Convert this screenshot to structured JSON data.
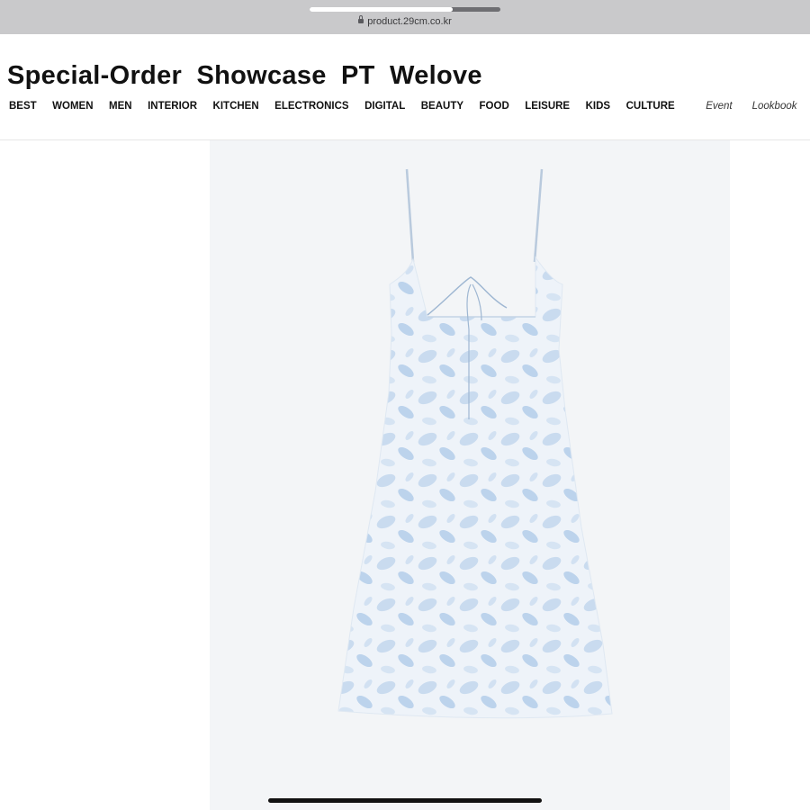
{
  "browser": {
    "url": "product.29cm.co.kr",
    "load_progress": 0.75
  },
  "site": {
    "title": "Special-Order  Showcase  PT  Welove"
  },
  "nav": {
    "categories": [
      "BEST",
      "WOMEN",
      "MEN",
      "INTERIOR",
      "KITCHEN",
      "ELECTRONICS",
      "DIGITAL",
      "BEAUTY",
      "FOOD",
      "LEISURE",
      "KIDS",
      "CULTURE"
    ],
    "links": [
      "Event",
      "Lookbook"
    ]
  },
  "product": {
    "image": "light-blue-floral-slip-dress"
  },
  "colors": {
    "chrome_bg": "#c9c9cb",
    "dress_base": "#eef3f9",
    "dress_pattern": "#bcd3ec"
  }
}
